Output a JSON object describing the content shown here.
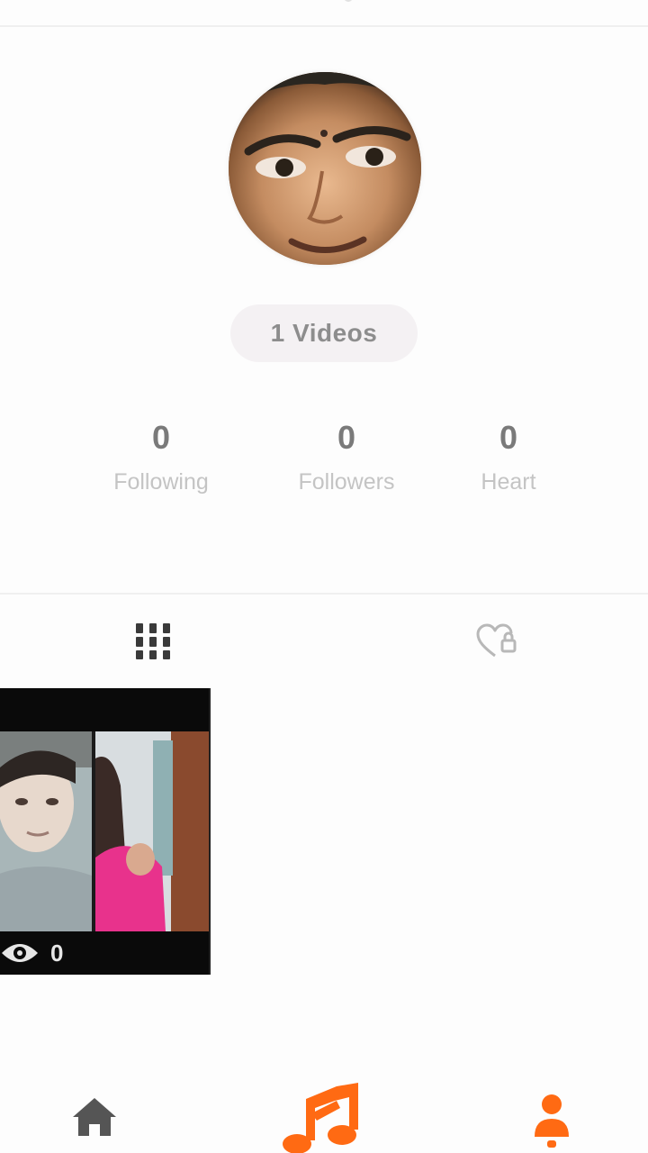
{
  "profile": {
    "videos_label": "1 Videos",
    "stats": [
      {
        "value": "0",
        "label": "Following"
      },
      {
        "value": "0",
        "label": "Followers"
      },
      {
        "value": "0",
        "label": "Heart"
      }
    ]
  },
  "tabs": [
    {
      "icon": "grid-icon",
      "selected": true
    },
    {
      "icon": "heart-lock-icon",
      "selected": false
    }
  ],
  "videos": [
    {
      "views": "0"
    }
  ],
  "bottom_nav": {
    "items": [
      {
        "icon": "home-icon"
      },
      {
        "icon": "music-note-icon"
      },
      {
        "icon": "profile-icon"
      }
    ],
    "accent_color": "#ff6a13",
    "inactive_color": "#555555"
  }
}
